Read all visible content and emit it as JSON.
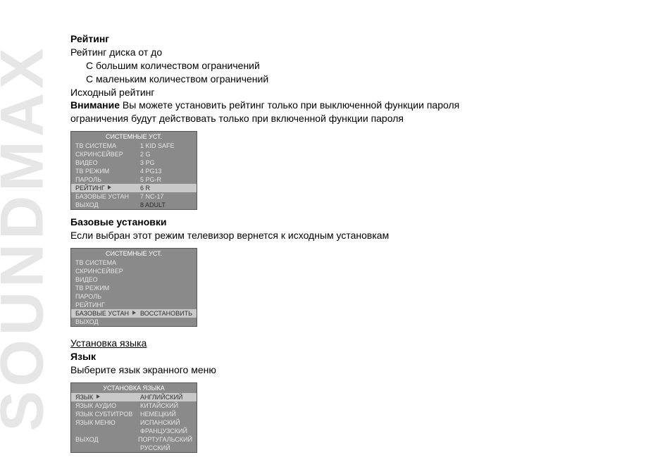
{
  "brand": "SOUNDMAX",
  "heading_rating": "Рейтинг",
  "rating_line": "Рейтинг диска от    до",
  "rating_more": "С большим количеством ограничений",
  "rating_less": "С маленьким количеством ограничений",
  "default_rating": "Исходный рейтинг",
  "attention_label": "Внимание",
  "attention_line1": "  Вы можете установить рейтинг только при выключенной функции пароля",
  "attention_line2": "ограничения будут действовать только при включенной функции пароля",
  "osd1": {
    "title": "СИСТЕМНЫЕ УСТ.",
    "left": [
      "ТВ СИСТЕМА",
      "СКРИНСЕЙВЕР",
      "ВИДЕО",
      "ТВ РЕЖИМ",
      "ПАРОЛЬ",
      "РЕЙТИНГ",
      "БАЗОВЫЕ УСТАН",
      "ВЫХОД"
    ],
    "right": [
      "1  KID SAFE",
      "2  G",
      "3  PG",
      "4  PG13",
      "5  PG-R",
      "6  R",
      "7  NC-17",
      "8  ADULT"
    ]
  },
  "heading_defaults": "Базовые установки",
  "defaults_line": "Если выбран этот режим  телевизор вернется к исходным установкам",
  "osd2": {
    "title": "СИСТЕМНЫЕ УСТ.",
    "left": [
      "ТВ СИСТЕМА",
      "СКРИНСЕЙВЕР",
      "ВИДЕО",
      "ТВ РЕЖИМ",
      "ПАРОЛЬ",
      "РЕЙТИНГ",
      "БАЗОВЫЕ УСТАН",
      "ВЫХОД"
    ],
    "right_selected": "ВОССТАНОВИТЬ"
  },
  "heading_lang_section": "Установка языка",
  "heading_language": "Язык",
  "language_line": "Выберите язык экранного меню",
  "osd3": {
    "title": "УСТАНОВКА ЯЗЫКА",
    "left": [
      "ЯЗЫК",
      "ЯЗЫК АУДИО",
      "ЯЗЫК СУБТИТРОВ",
      "ЯЗЫК МЕНЮ",
      "",
      "ВЫХОД"
    ],
    "right": [
      "АНГЛИЙСКИЙ",
      "КИТАЙСКИЙ",
      "НЕМЕЦКИЙ",
      "ИСПАНСКИЙ",
      "ФРАНЦУЗСКИЙ",
      "ПОРТУГАЛЬСКИЙ",
      "РУССКИЙ"
    ]
  }
}
